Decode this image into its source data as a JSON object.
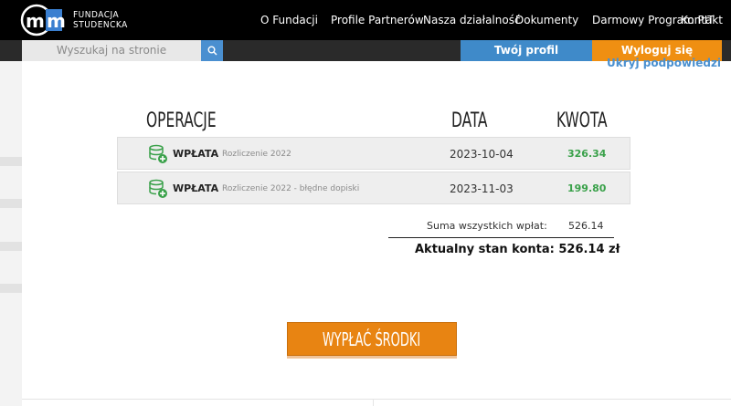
{
  "brand": {
    "line1": "FUNDACJA",
    "line2": "STUDENCKA"
  },
  "nav": [
    {
      "label": "O Fundacji"
    },
    {
      "label": "Profile Partnerów"
    },
    {
      "label": "Nasza działalność"
    },
    {
      "label": "Dokumenty"
    },
    {
      "label": "Darmowy Program PIT"
    },
    {
      "label": "Kontakt"
    }
  ],
  "search": {
    "placeholder": "Wyszukaj na stronie"
  },
  "profile_label": "Twój profil",
  "logout_label": "Wyloguj się",
  "hide_hints": "Ukryj podpowiedzi",
  "table": {
    "headers": {
      "operations": "OPERACJE",
      "date": "DATA",
      "amount": "KWOTA"
    },
    "rows": [
      {
        "type": "WPŁATA",
        "description": "Rozliczenie 2022",
        "date": "2023-10-04",
        "amount": "326.34"
      },
      {
        "type": "WPŁATA",
        "description": "Rozliczenie 2022 - błędne dopiski",
        "date": "2023-11-03",
        "amount": "199.80"
      }
    ]
  },
  "summary": {
    "total_label": "Suma wszystkich wpłat:",
    "total_value": "526.14",
    "balance": "Aktualny stan konta: 526.14 zł"
  },
  "withdraw_label": "WYPŁAĆ ŚRODKI",
  "colors": {
    "accent_orange": "#ef8f12",
    "accent_blue": "#3f8ac9",
    "amount_green": "#3aa14a"
  }
}
